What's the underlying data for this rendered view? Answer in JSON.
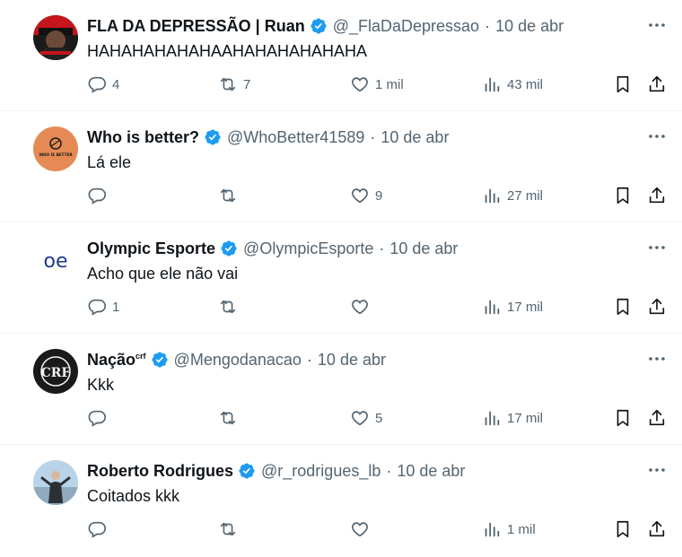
{
  "tweets": [
    {
      "name": "FLA DA DEPRESSÃO | Ruan",
      "name_sup": "",
      "handle": "@_FlaDaDepressao",
      "date": "10 de abr",
      "text": "HAHAHAHAHAHAAHAHAHAHAHAHA",
      "replies": "4",
      "retweets": "7",
      "likes": "1 mil",
      "views": "43 mil",
      "avatar": "fla-depressao-avatar"
    },
    {
      "name": "Who is better?",
      "name_sup": "",
      "handle": "@WhoBetter41589",
      "date": "10 de abr",
      "text": "Lá ele",
      "replies": "",
      "retweets": "",
      "likes": "9",
      "views": "27 mil",
      "avatar": "who-is-better-avatar",
      "avatar_text": "WHO IS BETTER"
    },
    {
      "name": "Olympic Esporte",
      "name_sup": "",
      "handle": "@OlympicEsporte",
      "date": "10 de abr",
      "text": "Acho que ele não vai",
      "replies": "1",
      "retweets": "",
      "likes": "",
      "views": "17 mil",
      "avatar": "olympic-esporte-avatar",
      "avatar_text": "oe"
    },
    {
      "name": "Nação",
      "name_sup": "crf",
      "handle": "@Mengodanacao",
      "date": "10 de abr",
      "text": "Kkk",
      "replies": "",
      "retweets": "",
      "likes": "5",
      "views": "17 mil",
      "avatar": "flamengo-crest-avatar",
      "avatar_text": "CRF"
    },
    {
      "name": "Roberto Rodrigues",
      "name_sup": "",
      "handle": "@r_rodrigues_lb",
      "date": "10 de abr",
      "text": "Coitados kkk",
      "replies": "",
      "retweets": "",
      "likes": "",
      "views": "1 mil",
      "avatar": "roberto-rodrigues-avatar"
    }
  ],
  "colors": {
    "text": "#0f1419",
    "muted": "#536471",
    "verified": "#1d9bf0",
    "divider": "#eff3f4"
  },
  "icons": [
    "reply-icon",
    "retweet-icon",
    "like-icon",
    "views-icon",
    "bookmark-icon",
    "share-icon",
    "more-icon",
    "verified-badge-icon"
  ]
}
